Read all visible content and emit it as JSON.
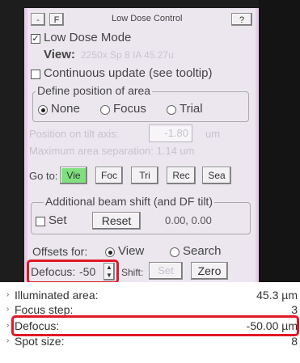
{
  "title_bar": {
    "minimize_label": "-",
    "float_label": "F",
    "title": "Low Dose Control",
    "help_label": "?"
  },
  "low_dose_mode": {
    "label": "Low Dose Mode",
    "checked": true
  },
  "view_info": {
    "label": "View:",
    "value": "2250x  Sp 8  IA 45.27u"
  },
  "continuous_update": {
    "label": "Continuous update (see tooltip)",
    "checked": false
  },
  "define_position": {
    "title": "Define position of area",
    "options": [
      {
        "label": "None",
        "selected": true
      },
      {
        "label": "Focus",
        "selected": false
      },
      {
        "label": "Trial",
        "selected": false
      }
    ]
  },
  "position_tilt": {
    "label": "Position on tilt axis:",
    "value": "-1.80",
    "unit": "um"
  },
  "max_separation": {
    "text": "Maximum area separation: 1.14 um"
  },
  "goto": {
    "label": "Go to:",
    "buttons": [
      {
        "label": "Vie",
        "active": true
      },
      {
        "label": "Foc",
        "active": false
      },
      {
        "label": "Tri",
        "active": false
      },
      {
        "label": "Rec",
        "active": false
      },
      {
        "label": "Sea",
        "active": false
      }
    ]
  },
  "beam_shift": {
    "title": "Additional beam shift (and DF tilt)",
    "set_label": "Set",
    "reset_label": "Reset",
    "value": "0.00, 0.00"
  },
  "offsets": {
    "label": "Offsets for:",
    "options": [
      {
        "label": "View",
        "selected": true
      },
      {
        "label": "Search",
        "selected": false
      }
    ]
  },
  "defocus_row": {
    "label": "Defocus:",
    "value": "-50",
    "shift_label": "Shift:",
    "set_label": "Set",
    "zero_label": "Zero"
  },
  "properties": [
    {
      "label": "Illuminated area:",
      "value": "45.3 µm"
    },
    {
      "label": "Focus step:",
      "value": "3"
    },
    {
      "label": "Defocus:",
      "value": "-50.00 µm"
    },
    {
      "label": "Spot size:",
      "value": "8"
    }
  ],
  "colors": {
    "highlight": "#e01828",
    "active_button": "#7ee07e",
    "panel_bg": "#ece7ef",
    "panel_border": "#e8cfe6"
  }
}
